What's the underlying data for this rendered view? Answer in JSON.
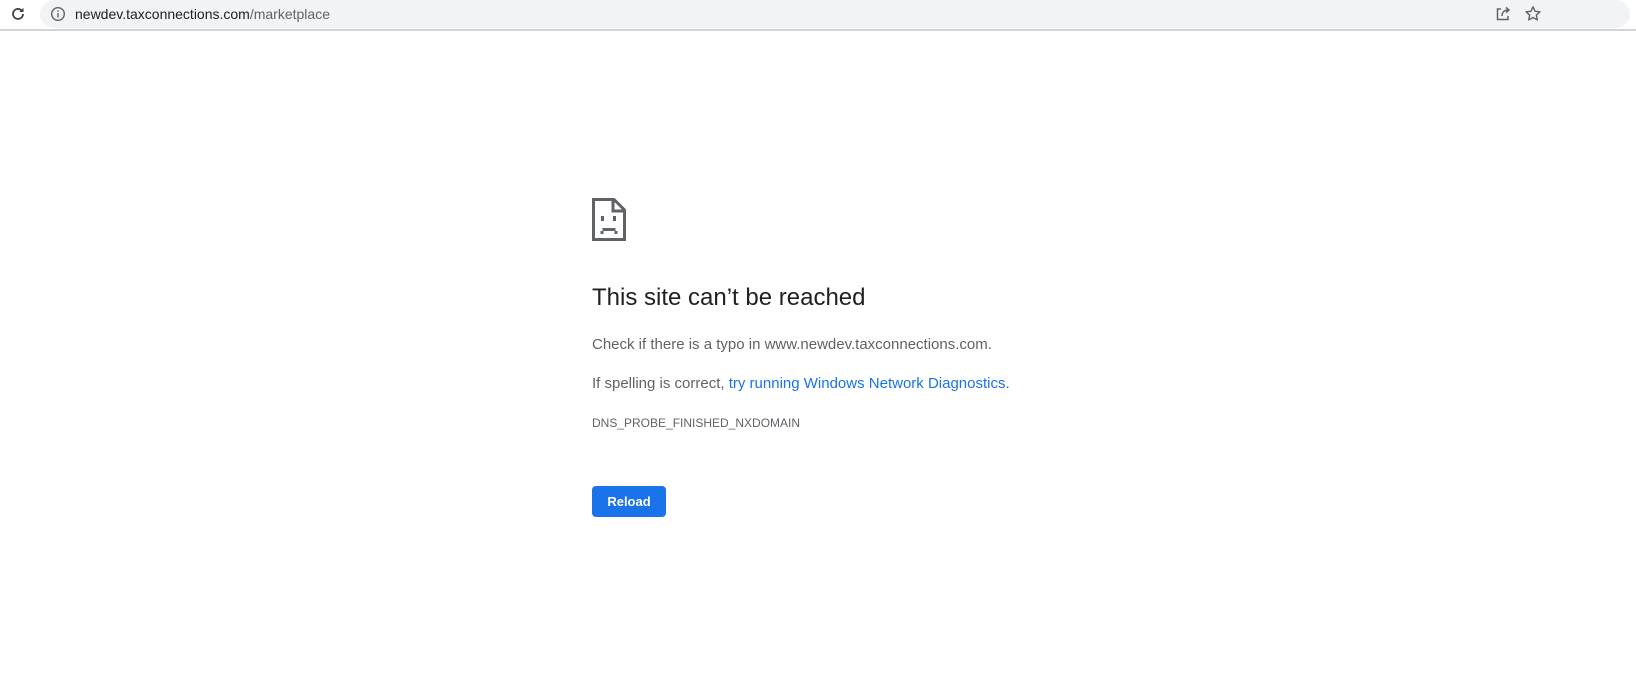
{
  "browser": {
    "url_host": "newdev.taxconnections.com",
    "url_path": "/marketplace",
    "icons": {
      "reload": "reload-icon",
      "site_info": "info-icon",
      "share": "share-icon",
      "bookmark": "star-icon"
    }
  },
  "error_page": {
    "icon": "sad-document-icon",
    "title": "This site can’t be reached",
    "check_text": "Check if there is a typo in www.newdev.taxconnections.com.",
    "spelling_prefix": "If spelling is correct, ",
    "diagnostics_link": "try running Windows Network Diagnostics",
    "spelling_suffix": ".",
    "error_code": "DNS_PROBE_FINISHED_NXDOMAIN",
    "reload_label": "Reload"
  },
  "colors": {
    "accent": "#1a73e8",
    "text_primary": "#202124",
    "text_secondary": "#5f6368",
    "omnibox_bg": "#f1f3f4"
  }
}
